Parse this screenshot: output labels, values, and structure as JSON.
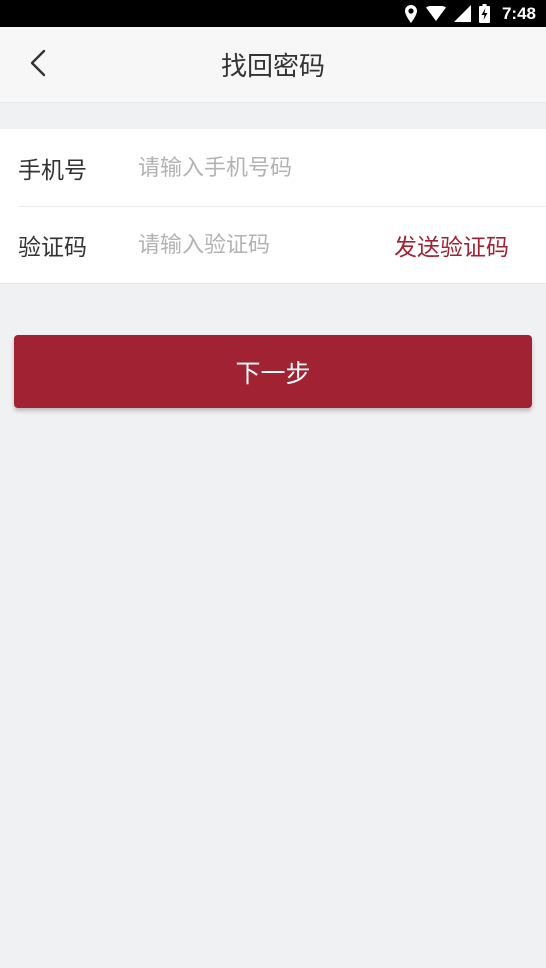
{
  "status_bar": {
    "time": "7:48",
    "icons": [
      "location-icon",
      "wifi-icon",
      "signal-icon",
      "battery-charging-icon"
    ]
  },
  "nav": {
    "back_icon": "chevron-left-icon",
    "title": "找回密码"
  },
  "form": {
    "phone": {
      "label": "手机号",
      "value": "",
      "placeholder": "请输入手机号码"
    },
    "code": {
      "label": "验证码",
      "value": "",
      "placeholder": "请输入验证码",
      "send_label": "发送验证码"
    }
  },
  "next_button": {
    "label": "下一步"
  },
  "colors": {
    "accent": "#a12233",
    "background": "#f0f1f3",
    "statusbar": "#000000"
  }
}
